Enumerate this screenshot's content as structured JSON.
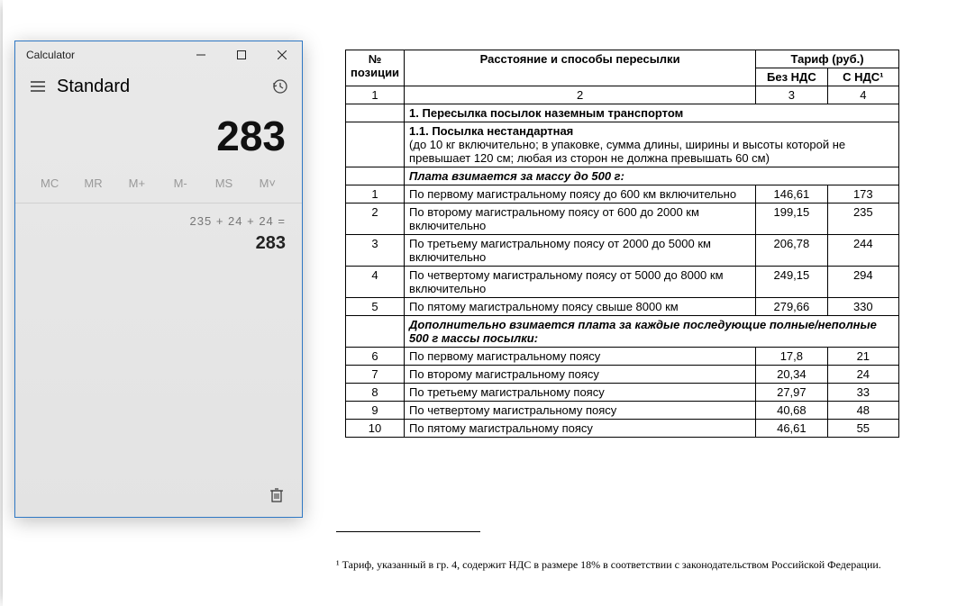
{
  "calc": {
    "title": "Calculator",
    "mode": "Standard",
    "display": "283",
    "memory": {
      "mc": "MC",
      "mr": "MR",
      "mplus": "M+",
      "mminus": "M-",
      "ms": "MS",
      "mcaret": "M˅"
    },
    "history": {
      "expr": "235  +  24  +  24 =",
      "result": "283"
    }
  },
  "doc": {
    "headers": {
      "pos": "№ позиции",
      "dist": "Расстояние и способы пересылки",
      "tariff": "Тариф (руб.)",
      "noVat": "Без НДС",
      "withVat": "С НДС¹"
    },
    "colNums": [
      "1",
      "2",
      "3",
      "4"
    ],
    "section1": "1. Пересылка посылок наземным транспортом",
    "section11_title": "1.1. Посылка нестандартная",
    "section11_note": "(до 10 кг включительно; в упаковке, сумма длины, ширины и высоты которой не превышает 120 см; любая из сторон не должна превышать 60 см)",
    "fee500": "Плата взимается за массу до 500 г:",
    "rows_a": [
      {
        "n": "1",
        "d": "По первому магистральному поясу до 600 км включительно",
        "t1": "146,61",
        "t2": "173"
      },
      {
        "n": "2",
        "d": "По второму магистральному поясу от 600 до 2000 км включительно",
        "t1": "199,15",
        "t2": "235"
      },
      {
        "n": "3",
        "d": "По третьему магистральному поясу от 2000 до 5000 км включительно",
        "t1": "206,78",
        "t2": "244"
      },
      {
        "n": "4",
        "d": "По четвертому магистральному поясу от 5000 до 8000 км включительно",
        "t1": "249,15",
        "t2": "294"
      },
      {
        "n": "5",
        "d": "По пятому магистральному поясу свыше 8000 км",
        "t1": "279,66",
        "t2": "330"
      }
    ],
    "extra": "Дополнительно взимается плата за каждые последующие полные/неполные 500 г массы посылки:",
    "rows_b": [
      {
        "n": "6",
        "d": "По первому магистральному поясу",
        "t1": "17,8",
        "t2": "21"
      },
      {
        "n": "7",
        "d": "По второму магистральному поясу",
        "t1": "20,34",
        "t2": "24"
      },
      {
        "n": "8",
        "d": "По третьему магистральному поясу",
        "t1": "27,97",
        "t2": "33"
      },
      {
        "n": "9",
        "d": "По четвертому магистральному поясу",
        "t1": "40,68",
        "t2": "48"
      },
      {
        "n": "10",
        "d": "По пятому магистральному поясу",
        "t1": "46,61",
        "t2": "55"
      }
    ],
    "footnote": "¹ Тариф, указанный в гр. 4, содержит НДС в размере 18% в соответствии с законодательством Российской Федерации."
  }
}
